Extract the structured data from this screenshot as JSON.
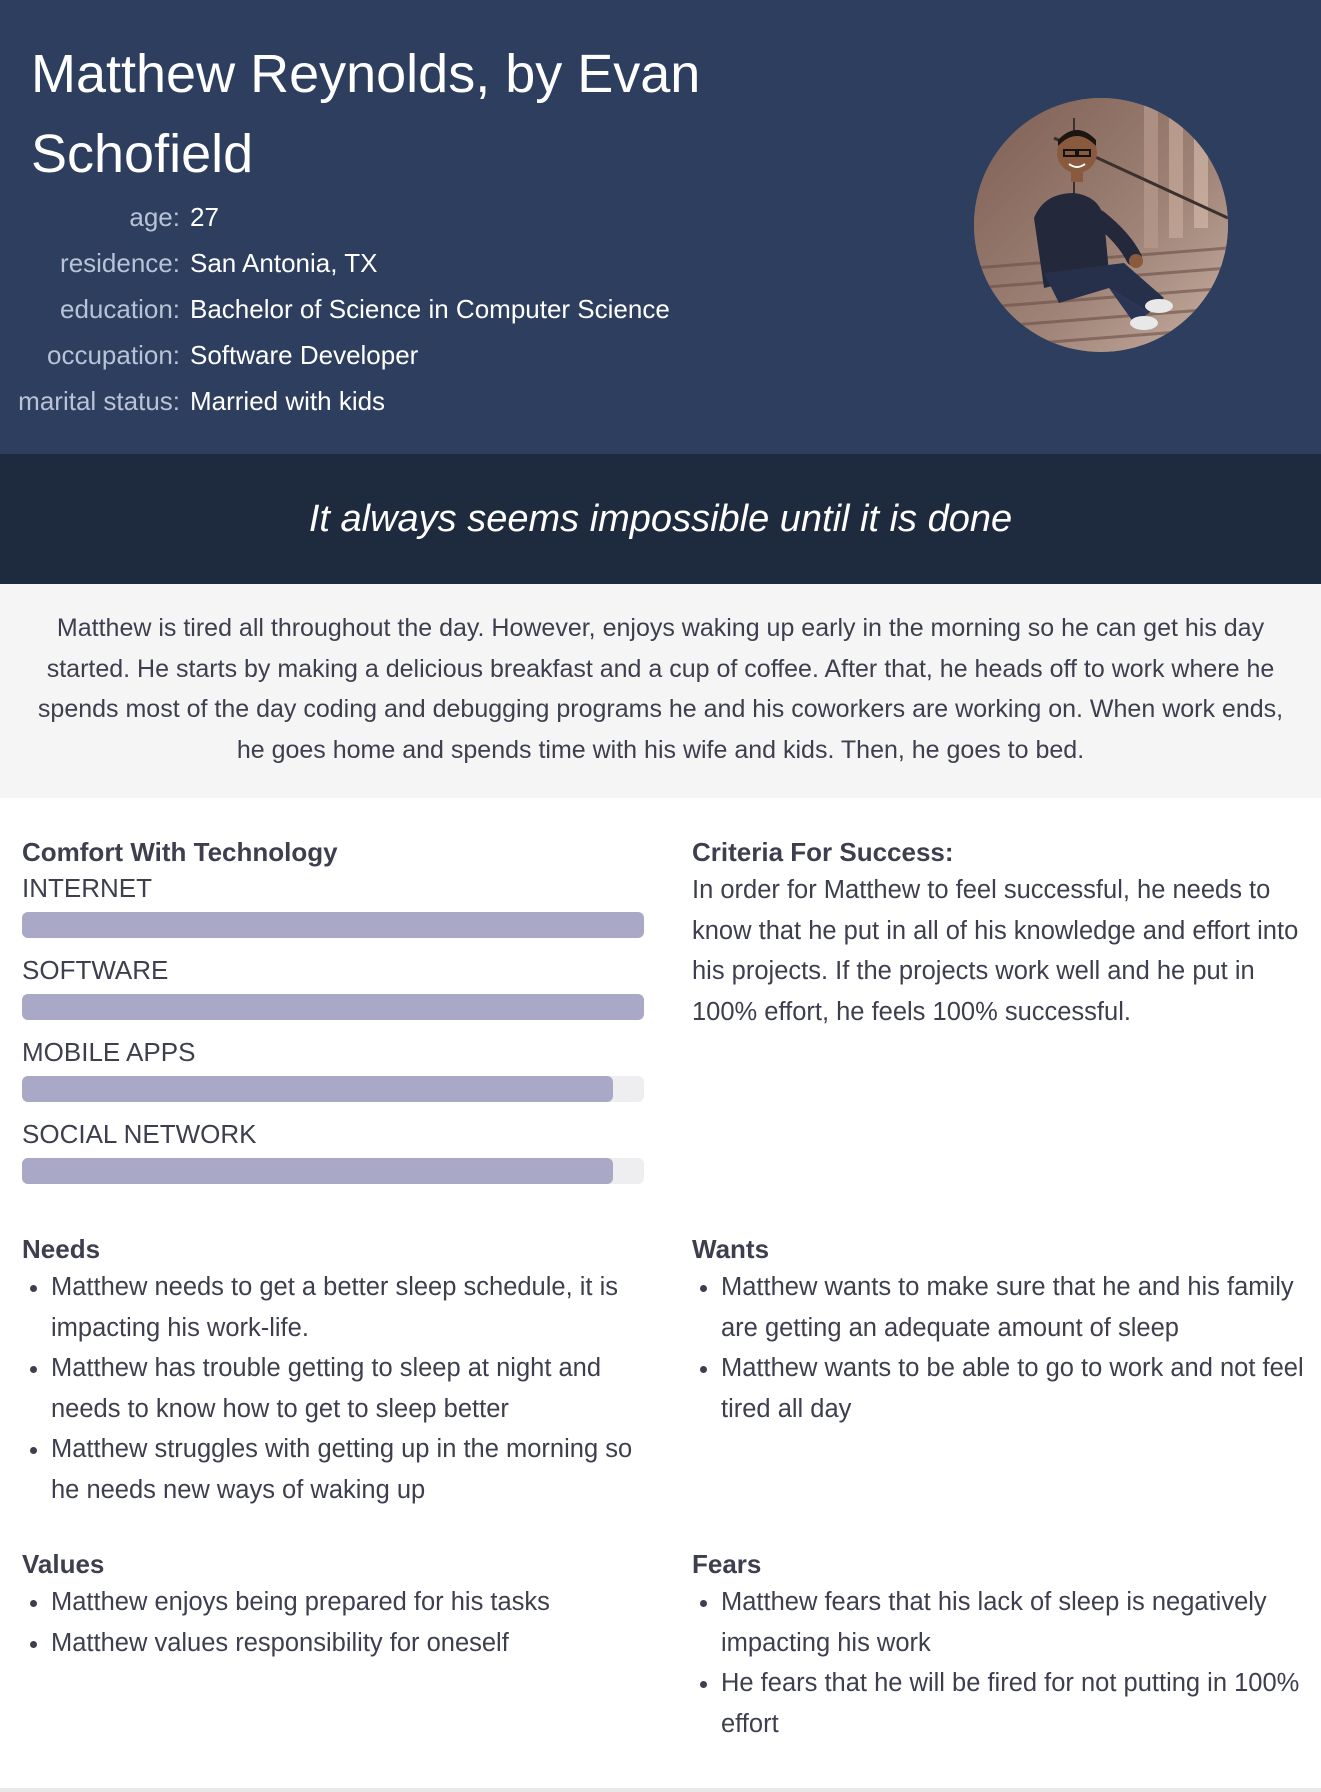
{
  "header": {
    "title": "Matthew Reynolds, by Evan Schofield",
    "facts": [
      {
        "label": "age:",
        "value": "27"
      },
      {
        "label": "residence:",
        "value": "San Antonia, TX"
      },
      {
        "label": "education:",
        "value": "Bachelor of Science in Computer Science"
      },
      {
        "label": "occupation:",
        "value": "Software Developer"
      },
      {
        "label": "marital status:",
        "value": "Married with kids"
      }
    ]
  },
  "quote": "It always seems impossible until it is done",
  "summary": "Matthew is tired all throughout the day. However, enjoys waking up early in the morning so he can get his day started. He starts by making a delicious breakfast and a cup of coffee. After that, he heads off to work where he spends most of the day coding and debugging programs he and his coworkers are working on. When work ends, he goes home and spends time with his wife and kids. Then, he goes to bed.",
  "comfort": {
    "title": "Comfort With Technology",
    "skills": [
      {
        "label": "INTERNET",
        "level": 1.0
      },
      {
        "label": "SOFTWARE",
        "level": 1.0
      },
      {
        "label": "MOBILE APPS",
        "level": 0.95
      },
      {
        "label": "SOCIAL NETWORK",
        "level": 0.95
      }
    ]
  },
  "criteria": {
    "title": "Criteria For Success:",
    "text": "In order for Matthew to feel successful, he needs to know that he put in all of his knowledge and effort into his projects. If the projects work well and he put in 100% effort, he feels 100% successful."
  },
  "needs": {
    "title": "Needs",
    "items": [
      "Matthew needs to get a better sleep schedule, it is impacting his work-life.",
      "Matthew has trouble getting to sleep at night and needs to know how to get to sleep better",
      "Matthew struggles with getting up in the morning so he needs new ways of waking up"
    ]
  },
  "wants": {
    "title": "Wants",
    "items": [
      "Matthew wants to make sure that he and his family are getting an adequate amount of sleep",
      "Matthew wants to be able to go to work and not feel tired all day"
    ]
  },
  "values": {
    "title": "Values",
    "items": [
      "Matthew enjoys being prepared for his tasks",
      "Matthew values responsibility for oneself"
    ]
  },
  "fears": {
    "title": "Fears",
    "items": [
      "Matthew fears that his lack of sleep is negatively impacting his work",
      "He fears that he will be fired for not putting in 100% effort"
    ]
  },
  "colors": {
    "header_bg": "#2d3e5f",
    "quote_bg": "#1e2a3d",
    "bar_fill": "#a9a8c6",
    "bar_track": "#eeeef0"
  }
}
